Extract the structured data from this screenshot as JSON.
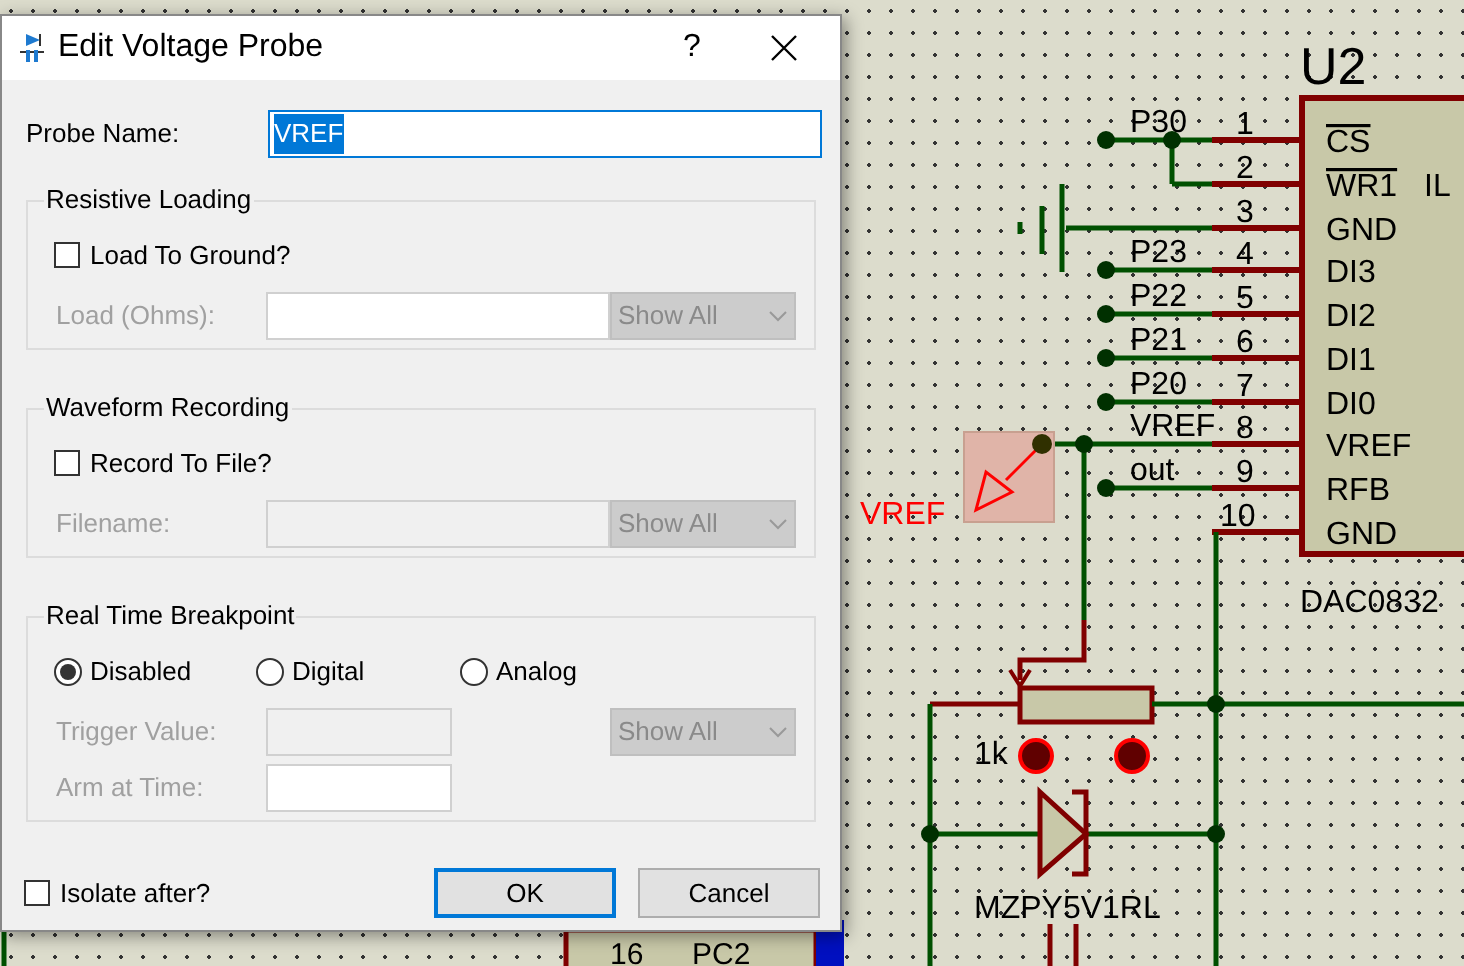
{
  "dialog": {
    "title": "Edit Voltage Probe",
    "help": "?",
    "probe_name": {
      "label": "Probe Name:",
      "value": "VREF",
      "selected": true
    },
    "resistive_loading": {
      "title": "Resistive Loading",
      "checkbox": {
        "label": "Load To Ground?",
        "checked": false
      },
      "field": {
        "label": "Load (Ohms):",
        "disabled": true,
        "shaded": false
      },
      "dropdown": {
        "value": "Show All",
        "disabled": true
      }
    },
    "waveform_recording": {
      "title": "Waveform Recording",
      "checkbox": {
        "label": "Record To File?",
        "checked": false
      },
      "field": {
        "label": "Filename:",
        "disabled": true,
        "shaded": true
      },
      "dropdown": {
        "value": "Show All",
        "disabled": true
      }
    },
    "breakpoint": {
      "title": "Real Time Breakpoint",
      "radios": [
        {
          "label": "Disabled",
          "selected": true
        },
        {
          "label": "Digital",
          "selected": false
        },
        {
          "label": "Analog",
          "selected": false
        }
      ],
      "trigger": {
        "label": "Trigger Value:",
        "disabled": true,
        "shaded": true
      },
      "dropdown": {
        "value": "Show All",
        "disabled": true
      },
      "arm": {
        "label": "Arm at Time:",
        "disabled": true,
        "shaded": false
      }
    },
    "isolate": {
      "label": "Isolate after?",
      "checked": false
    },
    "buttons": [
      {
        "label": "OK",
        "default": true
      },
      {
        "label": "Cancel",
        "default": false
      }
    ]
  },
  "schematic": {
    "chip": {
      "ref": "U2",
      "part": "DAC0832",
      "side_label": "IL",
      "pins": [
        {
          "number": "1",
          "name": "CS",
          "overbar": true,
          "net": "P30",
          "terminal": true
        },
        {
          "number": "2",
          "name": "WR1",
          "overbar": true,
          "terminal": false
        },
        {
          "number": "3",
          "name": "GND",
          "overbar": false,
          "terminal": false
        },
        {
          "number": "4",
          "name": "DI3",
          "overbar": false,
          "net": "P23",
          "terminal": true
        },
        {
          "number": "5",
          "name": "DI2",
          "overbar": false,
          "net": "P22",
          "terminal": true
        },
        {
          "number": "6",
          "name": "DI1",
          "overbar": false,
          "net": "P21",
          "terminal": true
        },
        {
          "number": "7",
          "name": "DI0",
          "overbar": false,
          "net": "P20",
          "terminal": true
        },
        {
          "number": "8",
          "name": "VREF",
          "overbar": false,
          "net": "VREF",
          "terminal": false
        },
        {
          "number": "9",
          "name": "RFB",
          "overbar": false,
          "net": "out",
          "terminal": true
        },
        {
          "number": "10",
          "name": "GND",
          "overbar": false,
          "terminal": false
        }
      ]
    },
    "probe": {
      "label": "VREF"
    },
    "resistor": {
      "value": "1k"
    },
    "diode": {
      "part": "MZPY5V1RL"
    },
    "other_part": {
      "pin": "16",
      "net": "PC2"
    }
  }
}
